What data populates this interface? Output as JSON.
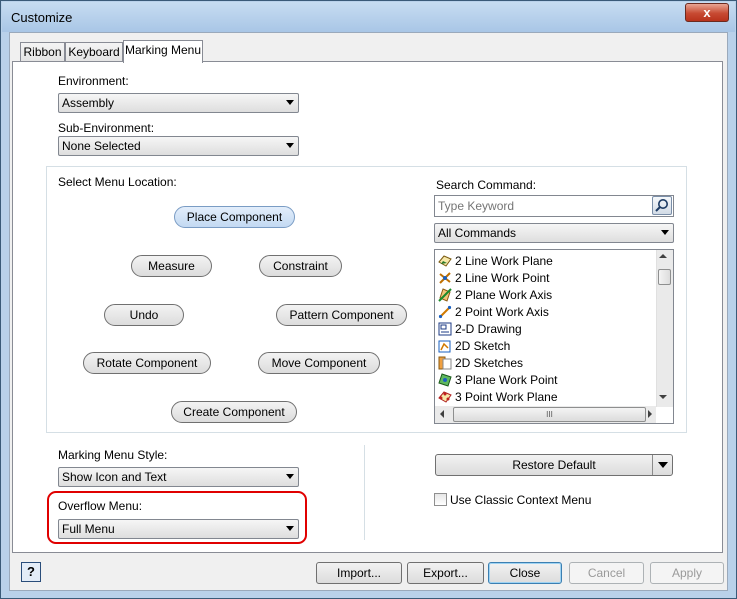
{
  "window": {
    "title": "Customize",
    "close": "x"
  },
  "tabs": [
    {
      "label": "Ribbon",
      "active": false
    },
    {
      "label": "Keyboard",
      "active": false
    },
    {
      "label": "Marking Menu",
      "active": true
    }
  ],
  "environment": {
    "label": "Environment:",
    "value": "Assembly"
  },
  "sub_environment": {
    "label": "Sub-Environment:",
    "value": "None Selected"
  },
  "menu_location": {
    "label": "Select Menu Location:",
    "items": {
      "place_component": "Place Component",
      "measure": "Measure",
      "constraint": "Constraint",
      "undo": "Undo",
      "pattern_component": "Pattern Component",
      "rotate_component": "Rotate Component",
      "move_component": "Move Component",
      "create_component": "Create Component"
    },
    "selected": "Place Component"
  },
  "search": {
    "label": "Search Command:",
    "placeholder": "Type Keyword",
    "filter_value": "All Commands",
    "commands": [
      {
        "label": "2 Line Work Plane",
        "icon": "work-plane-icon"
      },
      {
        "label": "2 Line Work Point",
        "icon": "work-point-icon"
      },
      {
        "label": "2 Plane Work Axis",
        "icon": "work-axis-icon"
      },
      {
        "label": "2 Point Work Axis",
        "icon": "work-axis-icon"
      },
      {
        "label": "2-D Drawing",
        "icon": "drawing-icon"
      },
      {
        "label": "2D Sketch",
        "icon": "sketch-icon"
      },
      {
        "label": "2D Sketches",
        "icon": "sketches-icon"
      },
      {
        "label": "3 Plane Work Point",
        "icon": "work-point-icon"
      },
      {
        "label": "3 Point Work Plane",
        "icon": "work-plane-icon"
      }
    ],
    "hscroll_thumb": "III"
  },
  "marking_menu_style": {
    "label": "Marking Menu Style:",
    "value": "Show Icon and Text"
  },
  "overflow_menu": {
    "label": "Overflow Menu:",
    "value": "Full Menu"
  },
  "restore_default": {
    "label": "Restore Default"
  },
  "classic_context": {
    "label": "Use Classic Context Menu",
    "checked": false
  },
  "footer": {
    "help": "?",
    "import": "Import...",
    "export": "Export...",
    "close": "Close",
    "cancel": "Cancel",
    "apply": "Apply"
  },
  "colors": {
    "highlight": "#e00000",
    "titlebar": "#b9d1ea"
  }
}
